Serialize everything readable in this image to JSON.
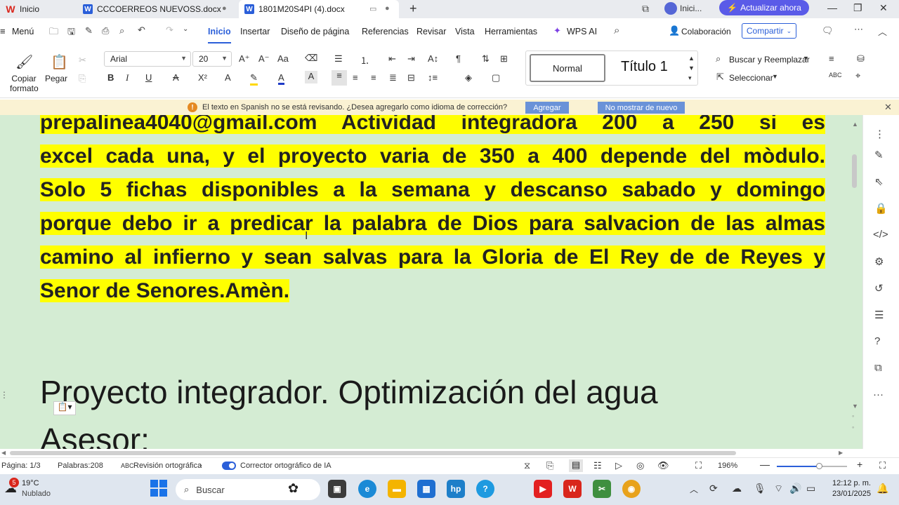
{
  "tabs": [
    {
      "label": "Inicio"
    },
    {
      "label": "CCCOERREOS  NUEVOSS.docx"
    },
    {
      "label": "1801M20S4PI (4).docx"
    }
  ],
  "titlebar": {
    "account_label": "Inici...",
    "upgrade_label": "Actualizar ahora"
  },
  "menu": {
    "menu_label": "Menú",
    "items": [
      "Inicio",
      "Insertar",
      "Diseño de página",
      "Referencias",
      "Revisar",
      "Vista",
      "Herramientas"
    ],
    "wps_ai": "WPS AI",
    "collab": "Colaboración",
    "share": "Compartir"
  },
  "ribbon": {
    "copy_format": "Copiar formato",
    "paste": "Pegar",
    "font": "Arial",
    "font_size": "20",
    "style_normal": "Normal",
    "style_title": "Título 1",
    "find_replace": "Buscar y Reemplazar",
    "select": "Seleccionar"
  },
  "notification": {
    "text": "El texto en Spanish no se está revisando. ¿Desea agregarlo como idioma de corrección?",
    "add_button": "Agregar",
    "dismiss_button": "No mostrar de nuevo"
  },
  "document": {
    "lines": [
      "prepalinea4040@gmail.com Actividad integradora 200 a 250 si es",
      "excel cada una, y el proyecto varia de 350 a 400 depende del mòdulo.",
      "Solo 5 fichas disponibles a la semana y descanso sabado y domingo",
      "porque debo ir a predicar la palabra de Dios para salvacion de las almas",
      "camino al infierno y sean salvas para la Gloria de El Rey de de Reyes y",
      "Senor de Senores.Amèn."
    ],
    "heading": "Proyecto integrador. Optimización del agua",
    "subheading": "Asesor:"
  },
  "status": {
    "page": "Página: 1/3",
    "words": "Palabras:208",
    "spell": "Revisión ortográfica",
    "ai_spell": "Corrector ortográfico de IA",
    "zoom": "196%"
  },
  "taskbar": {
    "weather_temp": "19°C",
    "weather_desc": "Nublado",
    "weather_badge": "5",
    "search_placeholder": "Buscar",
    "time": "12:12 p. m.",
    "date": "23/01/2025"
  },
  "colors": {
    "accent": "#2b5fd9",
    "highlight": "#ffff00",
    "page_background": "#d4ecd3",
    "notify_background": "#faf2d3"
  }
}
